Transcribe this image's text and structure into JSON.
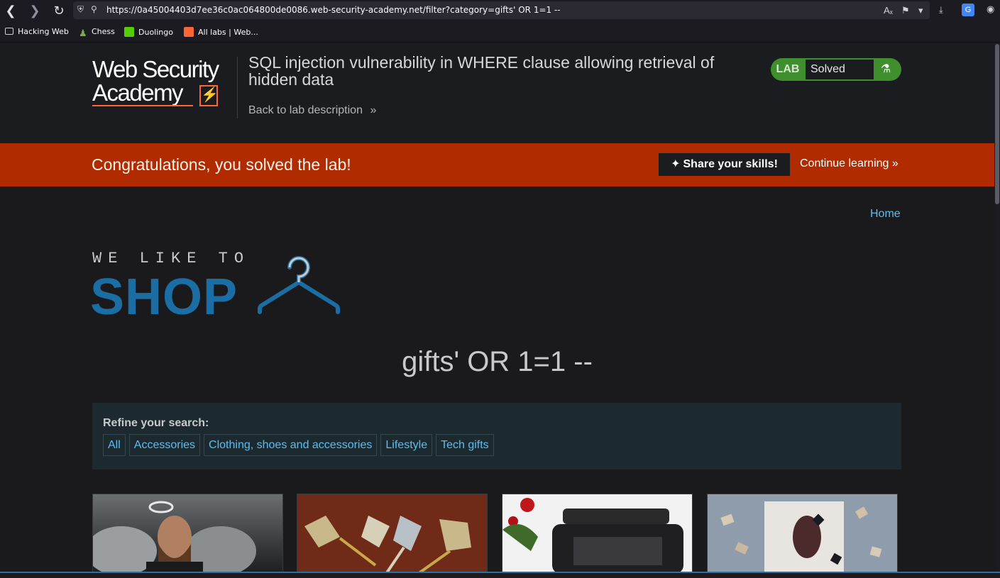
{
  "browser": {
    "url": "https://0a45004403d7ee36c0ac064800de0086.web-security-academy.net/filter?category=gifts' OR 1=1 --",
    "bookmarks": [
      {
        "label": "Hacking Web",
        "icon": "folder-icon"
      },
      {
        "label": "Chess",
        "icon": "chess-pawn-icon"
      },
      {
        "label": "Duolingo",
        "icon": "duolingo-icon"
      },
      {
        "label": "All labs | Web...",
        "icon": "portswigger-icon"
      }
    ]
  },
  "header": {
    "logo_line1": "Web Security",
    "logo_line2": "Academy",
    "lab_title": "SQL injection vulnerability in WHERE clause allowing retrieval of hidden data",
    "back_link": "Back to lab description",
    "lab_badge": "LAB",
    "lab_status": "Solved",
    "colors": {
      "status_green": "#3f8f2f",
      "accent_orange": "#ff6633"
    }
  },
  "banner": {
    "message": "Congratulations, you solved the lab!",
    "share_label": "Share your skills!",
    "continue_label": "Continue learning",
    "color": "#b12b00"
  },
  "shop": {
    "home_link": "Home",
    "logo_top": "WE LIKE TO",
    "logo_main": "SHOP",
    "search_term": "gifts' OR 1=1 --",
    "refine_label": "Refine your search:",
    "filters": [
      "All",
      "Accessories",
      "Clothing, shoes and accessories",
      "Lifestyle",
      "Tech gifts"
    ],
    "products": [
      {
        "image": "angel-man-image"
      },
      {
        "image": "darts-image"
      },
      {
        "image": "typewriter-roses-image"
      },
      {
        "image": "flying-books-image"
      }
    ]
  }
}
